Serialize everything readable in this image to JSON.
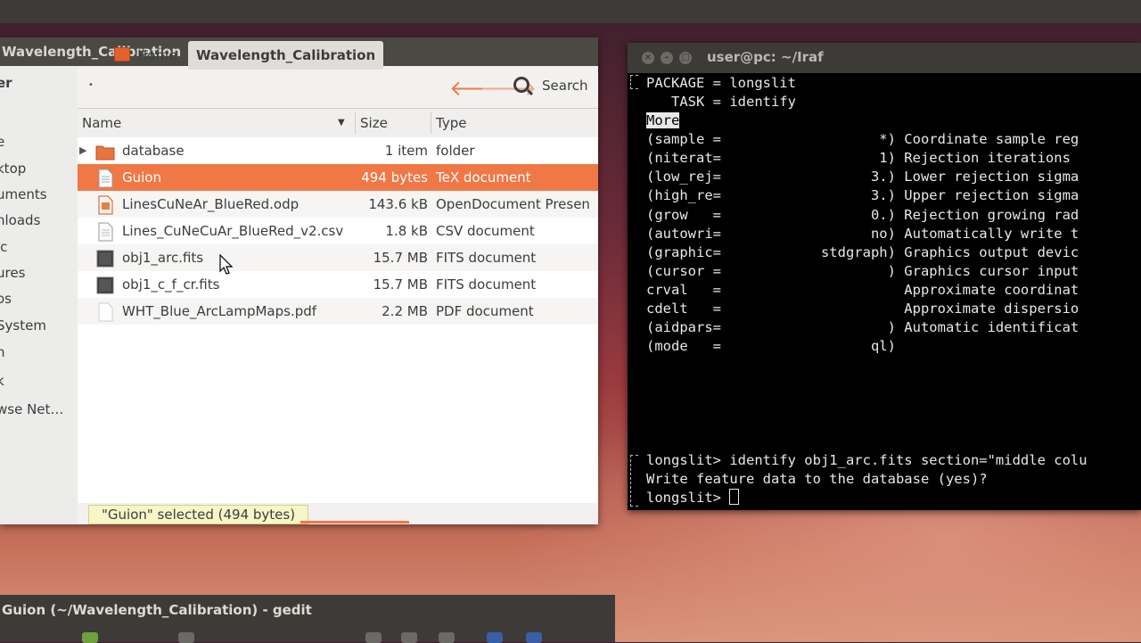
{
  "file_manager": {
    "window_title": "Wavelength_Calibration",
    "sidebar": {
      "heading": "er",
      "items": [
        "e",
        "ktop",
        "uments",
        "nloads",
        "ic",
        "ures",
        "os",
        "System",
        "h",
        "k",
        "wse Net…"
      ]
    },
    "breadcrumbs": {
      "home": "Home",
      "current": "Wavelength_Calibration"
    },
    "search_label": "Search",
    "columns": {
      "name": "Name",
      "size": "Size",
      "type": "Type"
    },
    "files": [
      {
        "name": "database",
        "size": "1 item",
        "type": "folder",
        "icon": "folder-icon"
      },
      {
        "name": "Guion",
        "size": "494 bytes",
        "type": "TeX document",
        "icon": "text-file-icon",
        "selected": true
      },
      {
        "name": "LinesCuNeAr_BlueRed.odp",
        "size": "143.6 kB",
        "type": "OpenDocument Presen",
        "icon": "presentation-file-icon"
      },
      {
        "name": "Lines_CuNeCuAr_BlueRed_v2.csv",
        "size": "1.8 kB",
        "type": "CSV document",
        "icon": "spreadsheet-file-icon"
      },
      {
        "name": "obj1_arc.fits",
        "size": "15.7 MB",
        "type": "FITS document",
        "icon": "fits-file-icon"
      },
      {
        "name": "obj1_c_f_cr.fits",
        "size": "15.7 MB",
        "type": "FITS document",
        "icon": "fits-file-icon"
      },
      {
        "name": "WHT_Blue_ArcLampMaps.pdf",
        "size": "2.2 MB",
        "type": "PDF document",
        "icon": "pdf-file-icon"
      }
    ],
    "status": "\"Guion\" selected (494 bytes)"
  },
  "terminal": {
    "title": "user@pc: ~/Iraf",
    "lines": [
      "PACKAGE = longslit",
      "   TASK = identify",
      "",
      "(sample =                   *) Coordinate sample reg",
      "(niterat=                   1) Rejection iterations",
      "(low_rej=                  3.) Lower rejection sigma",
      "(high_re=                  3.) Upper rejection sigma",
      "(grow   =                  0.) Rejection growing rad",
      "(autowri=                  no) Automatically write t",
      "(graphic=            stdgraph) Graphics output devic",
      "(cursor =                    ) Graphics cursor input",
      "crval   =                      Approximate coordinat",
      "cdelt   =                      Approximate dispersio",
      "(aidpars=                    ) Automatic identificat",
      "(mode   =                  ql)"
    ],
    "more_label": "More",
    "prompt_lines": [
      "longslit> identify obj1_arc.fits section=\"middle colu",
      "Write feature data to the database (yes)?",
      "longslit> "
    ]
  },
  "gedit": {
    "title": "Guion (~/Wavelength_Calibration) - gedit"
  },
  "colors": {
    "selection": "#f07746",
    "titlebar": "#3c3b37",
    "terminal_bg": "#000000"
  }
}
